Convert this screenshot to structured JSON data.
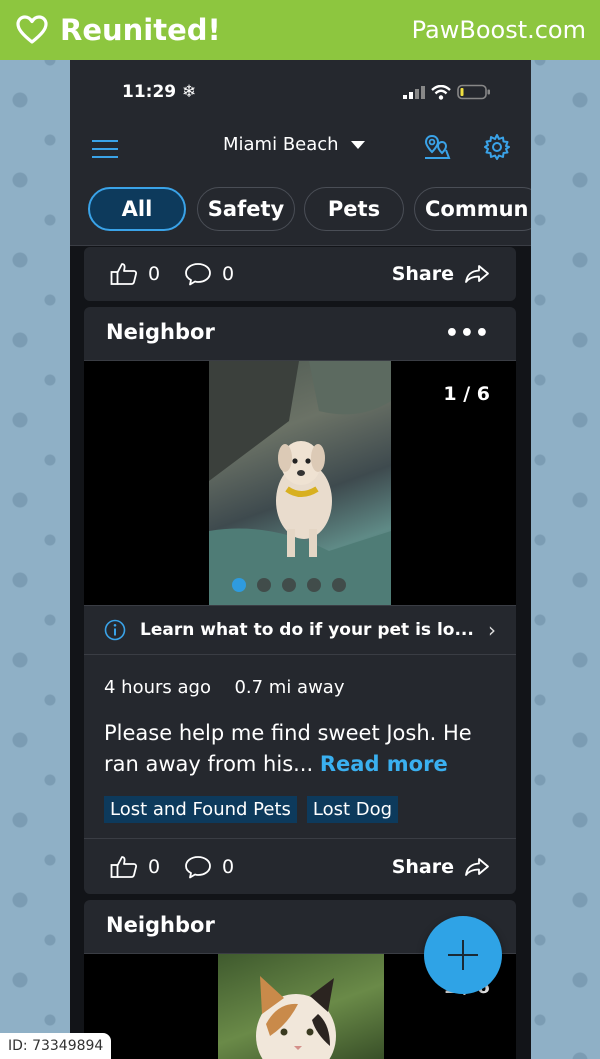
{
  "banner": {
    "title": "Reunited!",
    "brand": "PawBoost.com"
  },
  "status_bar": {
    "time": "11:29"
  },
  "app_bar": {
    "location": "Miami Beach"
  },
  "tabs": [
    {
      "label": "All",
      "active": true
    },
    {
      "label": "Safety",
      "active": false
    },
    {
      "label": "Pets",
      "active": false
    },
    {
      "label": "Commun",
      "active": false
    }
  ],
  "posts": [
    {
      "likes": "0",
      "comments": "0",
      "share_label": "Share"
    },
    {
      "author": "Neighbor",
      "photo_counter": "1 / 6",
      "learn_banner": "Learn what to do if your pet is lo...",
      "time_ago": "4 hours ago",
      "distance": "0.7 mi away",
      "text": "Please help me find sweet Josh. He ran away from his...",
      "read_more": "Read more",
      "tags": [
        "Lost and Found Pets",
        "Lost Dog"
      ],
      "likes": "0",
      "comments": "0",
      "share_label": "Share"
    },
    {
      "author": "Neighbor",
      "photo_counter": "1 / 6"
    }
  ],
  "footer": {
    "image_id": "ID: 73349894"
  },
  "colors": {
    "banner_green": "#8dc63f",
    "accent_blue": "#2fa3e6",
    "card_bg": "#25282e"
  }
}
